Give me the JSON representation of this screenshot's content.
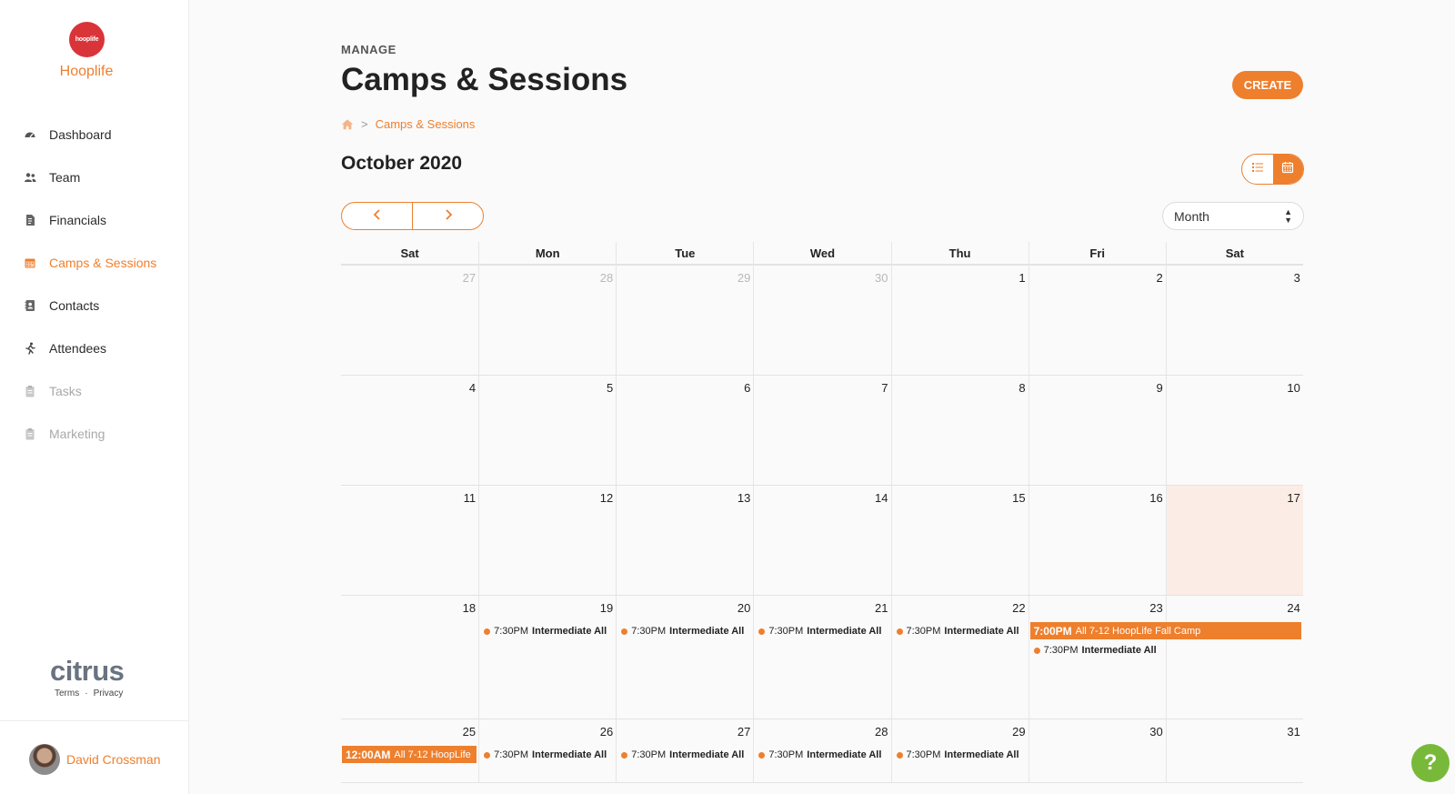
{
  "brand": {
    "logo_text": "hooplife",
    "name": "Hooplife"
  },
  "sidebar": {
    "items": [
      {
        "label": "Dashboard",
        "icon": "dashboard-icon",
        "state": "normal"
      },
      {
        "label": "Team",
        "icon": "team-icon",
        "state": "normal"
      },
      {
        "label": "Financials",
        "icon": "financials-icon",
        "state": "normal"
      },
      {
        "label": "Camps & Sessions",
        "icon": "calendar-icon",
        "state": "active"
      },
      {
        "label": "Contacts",
        "icon": "contacts-icon",
        "state": "normal"
      },
      {
        "label": "Attendees",
        "icon": "runner-icon",
        "state": "normal"
      },
      {
        "label": "Tasks",
        "icon": "clipboard-icon",
        "state": "disabled"
      },
      {
        "label": "Marketing",
        "icon": "clipboard-icon",
        "state": "disabled"
      }
    ],
    "footer": {
      "logo": "citrus",
      "terms": "Terms",
      "separator": "·",
      "privacy": "Privacy"
    },
    "user": {
      "name": "David Crossman"
    }
  },
  "header": {
    "section": "MANAGE",
    "title": "Camps & Sessions",
    "create_label": "CREATE",
    "breadcrumb": {
      "separator": ">",
      "current": "Camps & Sessions"
    }
  },
  "calendar": {
    "month_title": "October 2020",
    "view_select": "Month",
    "weekdays": [
      "Sat",
      "Mon",
      "Tue",
      "Wed",
      "Thu",
      "Fri",
      "Sat"
    ],
    "weeks": [
      {
        "days": [
          {
            "num": "27",
            "other": true
          },
          {
            "num": "28",
            "other": true
          },
          {
            "num": "29",
            "other": true
          },
          {
            "num": "30",
            "other": true
          },
          {
            "num": "1"
          },
          {
            "num": "2"
          },
          {
            "num": "3"
          }
        ]
      },
      {
        "days": [
          {
            "num": "4"
          },
          {
            "num": "5"
          },
          {
            "num": "6"
          },
          {
            "num": "7"
          },
          {
            "num": "8"
          },
          {
            "num": "9"
          },
          {
            "num": "10"
          }
        ]
      },
      {
        "days": [
          {
            "num": "11"
          },
          {
            "num": "12"
          },
          {
            "num": "13"
          },
          {
            "num": "14"
          },
          {
            "num": "15"
          },
          {
            "num": "16"
          },
          {
            "num": "17",
            "today": true
          }
        ]
      },
      {
        "days": [
          {
            "num": "18"
          },
          {
            "num": "19",
            "events": [
              {
                "type": "dot",
                "time": "7:30PM",
                "title": "Intermediate All"
              }
            ]
          },
          {
            "num": "20",
            "events": [
              {
                "type": "dot",
                "time": "7:30PM",
                "title": "Intermediate All"
              }
            ]
          },
          {
            "num": "21",
            "events": [
              {
                "type": "dot",
                "time": "7:30PM",
                "title": "Intermediate All"
              }
            ]
          },
          {
            "num": "22",
            "events": [
              {
                "type": "dot",
                "time": "7:30PM",
                "title": "Intermediate All"
              }
            ]
          },
          {
            "num": "23",
            "events": [
              {
                "type": "bar",
                "span": 2,
                "time": "7:00PM",
                "title": "All 7-12 HoopLife Fall Camp"
              },
              {
                "type": "dot",
                "time": "7:30PM",
                "title": "Intermediate All"
              }
            ]
          },
          {
            "num": "24"
          }
        ]
      },
      {
        "days": [
          {
            "num": "25",
            "events": [
              {
                "type": "bar",
                "span": 1,
                "time": "12:00AM",
                "title": "All 7-12 HoopLife"
              }
            ]
          },
          {
            "num": "26",
            "events": [
              {
                "type": "dot",
                "time": "7:30PM",
                "title": "Intermediate All"
              }
            ]
          },
          {
            "num": "27",
            "events": [
              {
                "type": "dot",
                "time": "7:30PM",
                "title": "Intermediate All"
              }
            ]
          },
          {
            "num": "28",
            "events": [
              {
                "type": "dot",
                "time": "7:30PM",
                "title": "Intermediate All"
              }
            ]
          },
          {
            "num": "29",
            "events": [
              {
                "type": "dot",
                "time": "7:30PM",
                "title": "Intermediate All"
              }
            ]
          },
          {
            "num": "30"
          },
          {
            "num": "31"
          }
        ]
      }
    ]
  },
  "help": {
    "label": "?"
  },
  "colors": {
    "accent": "#ee7f2d",
    "today_bg": "#fbede5",
    "help": "#79b93a",
    "logo_red": "#d9343a"
  }
}
